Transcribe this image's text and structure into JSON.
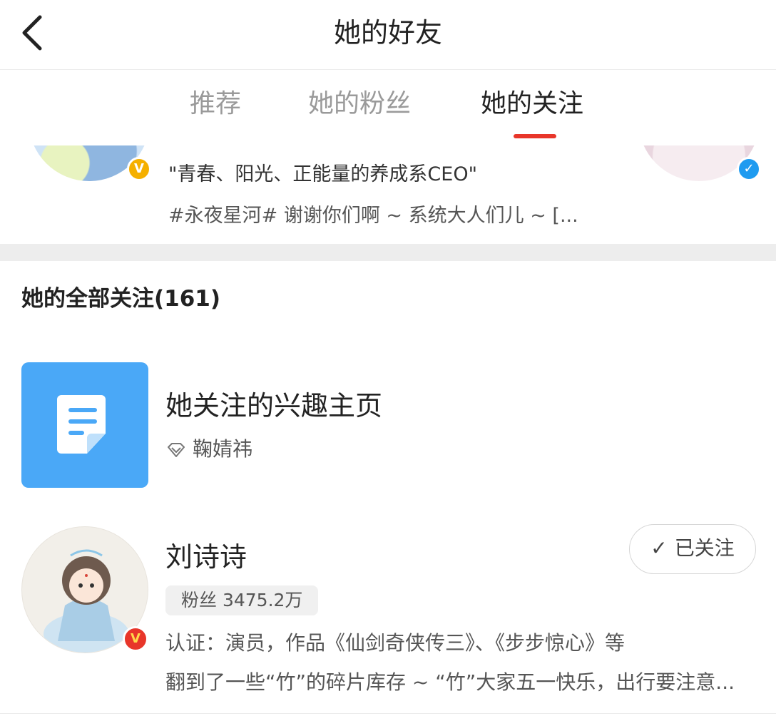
{
  "header": {
    "title": "她的好友"
  },
  "tabs": [
    {
      "label": "推荐"
    },
    {
      "label": "她的粉丝"
    },
    {
      "label": "她的关注"
    }
  ],
  "recommend_card": {
    "line1": "\"青春、阳光、正能量的养成系CEO\"",
    "line2": "#永夜星河# 谢谢你们啊 ~ 系统大人们儿 ~ [..."
  },
  "section": {
    "title": "她的全部关注(161)"
  },
  "interest_page": {
    "title": "她关注的兴趣主页",
    "owner": "鞠婧祎"
  },
  "user": {
    "name": "刘诗诗",
    "follow_label": "已关注",
    "fans": "粉丝 3475.2万",
    "verification": "认证：演员，作品《仙剑奇侠传三》、《步步惊心》等",
    "description": "翻到了一些“竹”的碎片库存 ~ “竹”大家五一快乐，出行要注意..."
  },
  "colors": {
    "accent": "#e8362a",
    "tile": "#4aa8f7",
    "verified_blue": "#1f9bf0",
    "verified_gold": "#f5b000"
  },
  "icons": [
    "back-arrow-icon",
    "verified-badge-icon",
    "document-icon",
    "diamond-icon",
    "checkmark-icon"
  ]
}
